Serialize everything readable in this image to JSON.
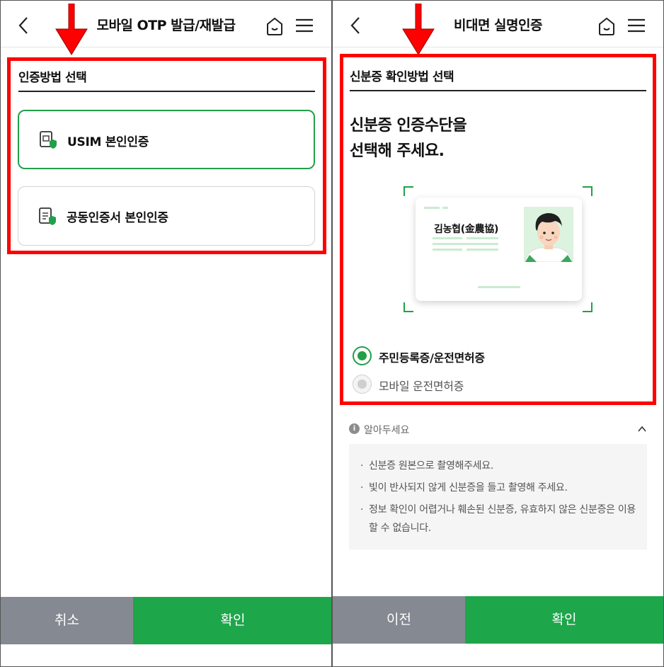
{
  "left": {
    "header": {
      "title": "모바일 OTP 발급/재발급"
    },
    "section_title": "인증방법 선택",
    "methods": [
      {
        "label": "USIM 본인인증",
        "icon": "usim-shield-icon",
        "selected": true
      },
      {
        "label": "공동인증서 본인인증",
        "icon": "document-shield-icon",
        "selected": false
      }
    ],
    "buttons": {
      "cancel": "취소",
      "confirm": "확인"
    }
  },
  "right": {
    "header": {
      "title": "비대면 실명인증"
    },
    "section_title": "신분증 확인방법 선택",
    "prompt_line1": "신분증 인증수단을",
    "prompt_line2": "선택해 주세요.",
    "id_card": {
      "name": "김농협(金農協)"
    },
    "options": [
      {
        "label": "주민등록증/운전면허증",
        "selected": true
      },
      {
        "label": "모바일 운전면허증",
        "selected": false
      }
    ],
    "notice": {
      "title": "알아두세요",
      "bullet": "·",
      "items": [
        "신분증 원본으로 촬영해주세요.",
        "빛이 반사되지 않게 신분증을 들고 촬영해 주세요.",
        "정보 확인이 어렵거나 훼손된 신분증, 유효하지 않은 신분증은 이용할 수 없습니다."
      ]
    },
    "buttons": {
      "prev": "이전",
      "confirm": "확인"
    }
  },
  "colors": {
    "accent": "#1ea64a",
    "highlight": "#ff0000",
    "button_gray": "#858991"
  }
}
